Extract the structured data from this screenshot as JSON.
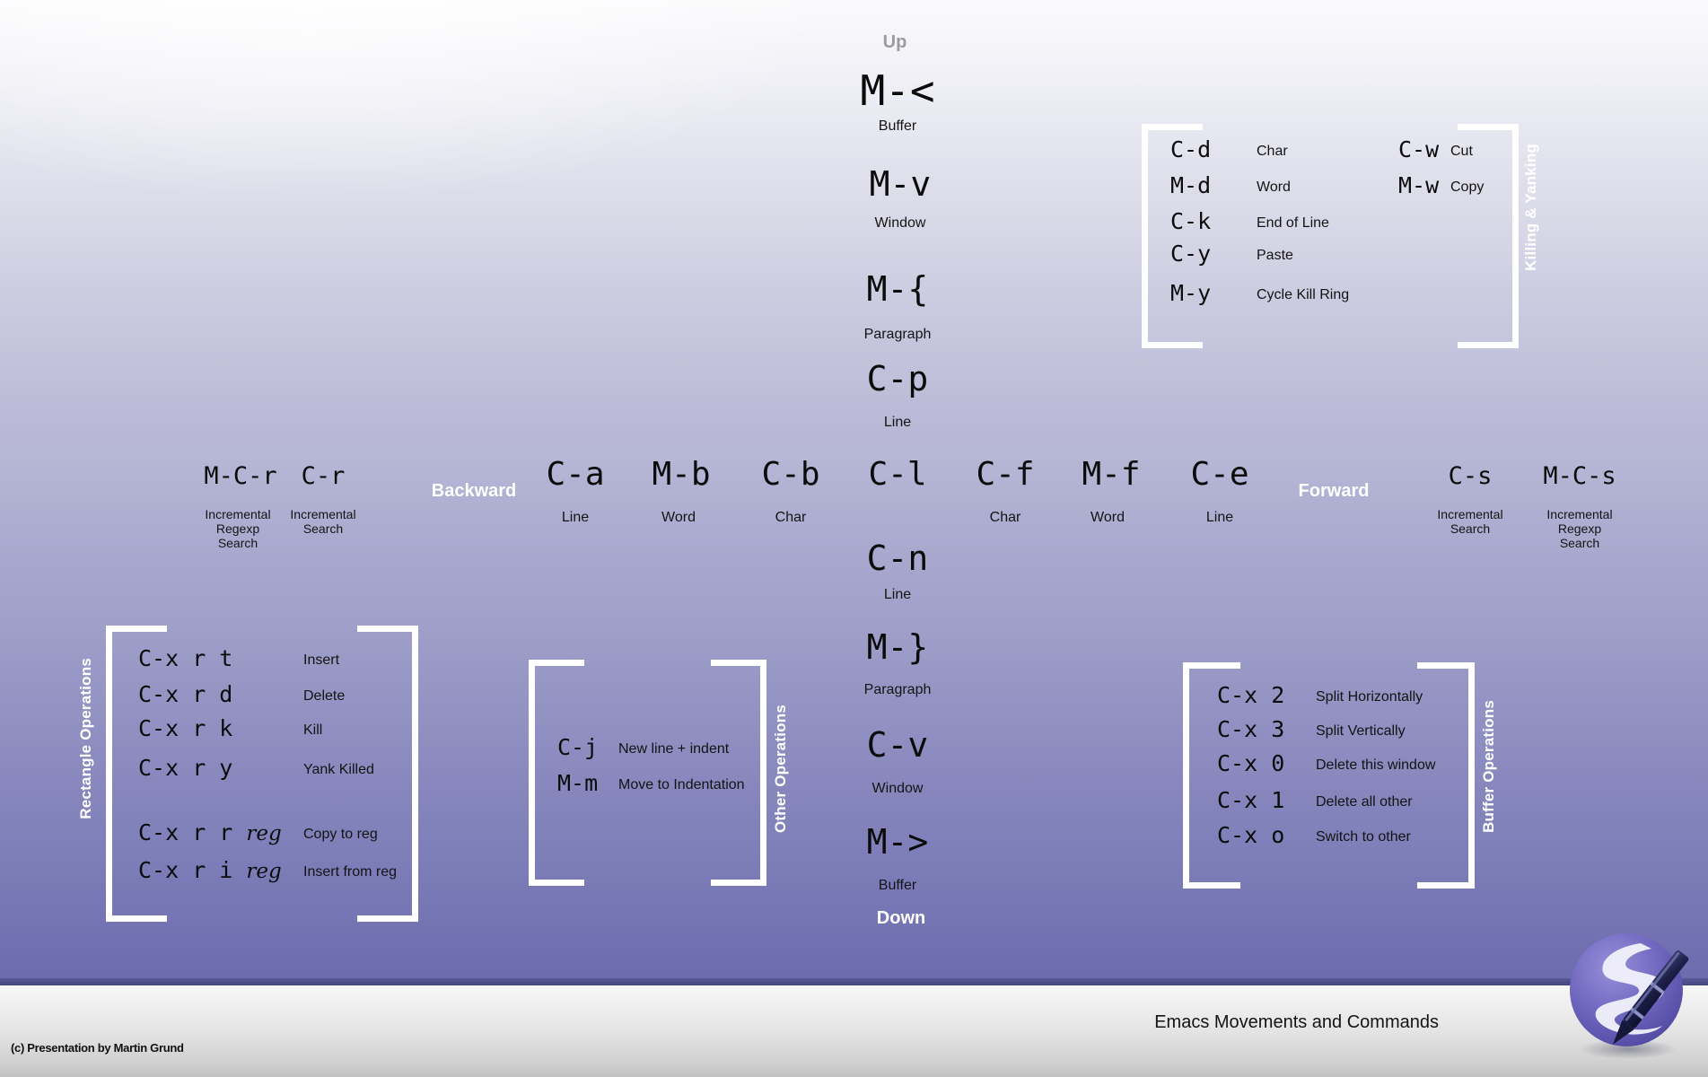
{
  "footer": {
    "title": "Emacs Movements and Commands",
    "copyright": "(c) Presentation by Martin Grund"
  },
  "directions": {
    "up": "Up",
    "down": "Down",
    "backward": "Backward",
    "forward": "Forward"
  },
  "vertical_up": [
    {
      "key": "M-<",
      "label": "Buffer"
    },
    {
      "key": "M-v",
      "label": "Window"
    },
    {
      "key": "M-{",
      "label": "Paragraph"
    },
    {
      "key": "C-p",
      "label": "Line"
    }
  ],
  "vertical_down": [
    {
      "key": "C-n",
      "label": "Line"
    },
    {
      "key": "M-}",
      "label": "Paragraph"
    },
    {
      "key": "C-v",
      "label": "Window"
    },
    {
      "key": "M->",
      "label": "Buffer"
    }
  ],
  "horizontal": [
    {
      "key": "M-C-r",
      "label": "Incremental\nRegexp\nSearch"
    },
    {
      "key": "C-r",
      "label": "Incremental\nSearch"
    },
    {
      "key": "C-a",
      "label": "Line"
    },
    {
      "key": "M-b",
      "label": "Word"
    },
    {
      "key": "C-b",
      "label": "Char"
    },
    {
      "key": "C-l",
      "label": ""
    },
    {
      "key": "C-f",
      "label": "Char"
    },
    {
      "key": "M-f",
      "label": "Word"
    },
    {
      "key": "C-e",
      "label": "Line"
    },
    {
      "key": "C-s",
      "label": "Incremental\nSearch"
    },
    {
      "key": "M-C-s",
      "label": "Incremental\nRegexp\nSearch"
    }
  ],
  "killing_yanking": {
    "title": "Killing & Yanking",
    "col1": [
      {
        "key": "C-d",
        "desc": "Char"
      },
      {
        "key": "M-d",
        "desc": "Word"
      },
      {
        "key": "C-k",
        "desc": "End of Line"
      },
      {
        "key": "C-y",
        "desc": "Paste"
      },
      {
        "key": "M-y",
        "desc": "Cycle Kill Ring"
      }
    ],
    "col2": [
      {
        "key": "C-w",
        "desc": "Cut"
      },
      {
        "key": "M-w",
        "desc": "Copy"
      }
    ]
  },
  "rectangle_operations": {
    "title": "Rectangle Operations",
    "items": [
      {
        "key": "C-x r t",
        "arg": "",
        "desc": "Insert"
      },
      {
        "key": "C-x r d",
        "arg": "",
        "desc": "Delete"
      },
      {
        "key": "C-x r k",
        "arg": "",
        "desc": "Kill"
      },
      {
        "key": "C-x r y",
        "arg": "",
        "desc": "Yank Killed"
      },
      {
        "key": "C-x r r",
        "arg": "reg",
        "desc": "Copy to reg"
      },
      {
        "key": "C-x r i",
        "arg": "reg",
        "desc": "Insert from reg"
      }
    ]
  },
  "other_operations": {
    "title": "Other Operations",
    "items": [
      {
        "key": "C-j",
        "desc": "New line + indent"
      },
      {
        "key": "M-m",
        "desc": "Move to Indentation"
      }
    ]
  },
  "buffer_operations": {
    "title": "Buffer Operations",
    "items": [
      {
        "key": "C-x 2",
        "desc": "Split Horizontally"
      },
      {
        "key": "C-x 3",
        "desc": "Split Vertically"
      },
      {
        "key": "C-x 0",
        "desc": "Delete this window"
      },
      {
        "key": "C-x 1",
        "desc": "Delete all other"
      },
      {
        "key": "C-x o",
        "desc": "Switch to other"
      }
    ]
  },
  "colors": {
    "panel_top": "#fbfbfd",
    "panel_bottom": "#6a6aad",
    "bracket": "#ffffff",
    "logo_purple": "#6a62b8",
    "accent_white": "#ffffff"
  }
}
